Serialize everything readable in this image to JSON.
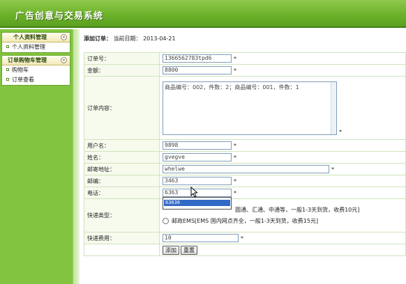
{
  "header": {
    "title": "广告创意与交易系统"
  },
  "sidebar": {
    "panels": [
      {
        "title": "个人资料管理",
        "toggle": "«",
        "items": [
          {
            "label": "个人资料管理"
          }
        ]
      },
      {
        "title": "订单购物车管理",
        "toggle": "«",
        "items": [
          {
            "label": "购物车"
          },
          {
            "label": "订单查看"
          }
        ]
      }
    ]
  },
  "main": {
    "breadcrumb": {
      "section": "添加订单：",
      "date_label": "当前日期：",
      "date": "2013-04-21"
    },
    "form": {
      "order_no": {
        "label": "订单号：",
        "value": "1366562783tpd6"
      },
      "amount": {
        "label": "金额：",
        "value": "8800"
      },
      "content": {
        "label": "订单内容：",
        "value": "商品编号：002，件数：2；商品编号：001，件数：1"
      },
      "username": {
        "label": "用户名：",
        "value": "9898"
      },
      "name": {
        "label": "姓名：",
        "value": "gvegve"
      },
      "address": {
        "label": "邮寄地址：",
        "value": "whelwe"
      },
      "zip": {
        "label": "邮编：",
        "value": "3463"
      },
      "phone": {
        "label": "电话：",
        "value": "6363",
        "suggestion": "63636"
      },
      "ship_type": {
        "label": "快递类型：",
        "options": [
          {
            "label": "普通快递[如：圆通、汇通、中通等，一般1-3天到货，收费10元]",
            "visible_text": "圆通、汇通、中通等，一般1-3天到货，收费10元]",
            "checked": true
          },
          {
            "label": "邮政EMS[EMS 国内网点齐全，一般1-3天到货，收费15元]",
            "checked": false
          }
        ]
      },
      "ship_fee": {
        "label": "快递费用：",
        "value": "10"
      },
      "required_mark": "*"
    },
    "buttons": {
      "add": "添加",
      "reset": "重置"
    }
  }
}
